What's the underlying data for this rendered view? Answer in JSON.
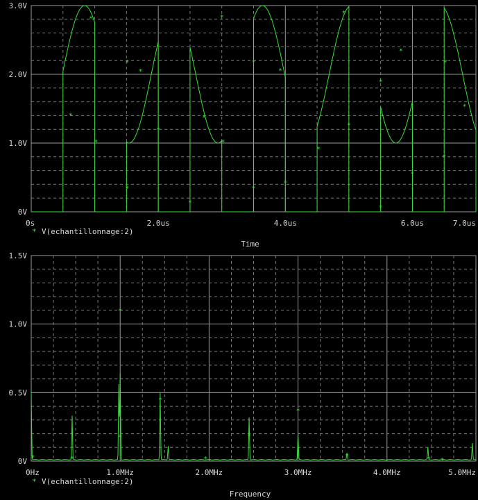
{
  "chart_data": [
    {
      "type": "line",
      "xlabel": "Time",
      "x_unit": "us",
      "ylim": [
        0,
        3.0
      ],
      "xlim": [
        0,
        7.0
      ],
      "grid": true,
      "legend_placement": "below-left",
      "series_color": "#38e038",
      "x_ticks": [
        {
          "value": 0,
          "label": "0s"
        },
        {
          "value": 2.0,
          "label": "2.0us"
        },
        {
          "value": 4.0,
          "label": "4.0us"
        },
        {
          "value": 6.0,
          "label": "6.0us"
        },
        {
          "value": 7.0,
          "label": "7.0us"
        }
      ],
      "y_ticks": [
        {
          "value": 0,
          "label": "0V"
        },
        {
          "value": 1.0,
          "label": "1.0V"
        },
        {
          "value": 2.0,
          "label": "2.0V"
        },
        {
          "value": 3.0,
          "label": "3.0V"
        }
      ],
      "signal": {
        "offset": 2.0,
        "amplitude": 1.0,
        "period_us": 1.4,
        "phase_us": 0.84
      },
      "gates": [
        {
          "on": 0.5,
          "off": 1.0
        },
        {
          "on": 1.5,
          "off": 2.0
        },
        {
          "on": 2.5,
          "off": 3.0
        },
        {
          "on": 3.5,
          "off": 4.0
        },
        {
          "on": 4.5,
          "off": 5.0
        },
        {
          "on": 5.5,
          "off": 6.0
        },
        {
          "on": 6.5,
          "off": 7.0
        }
      ],
      "series": [
        {
          "name": "V(echantillonnage:2)",
          "markers": [
            [
              0.62,
              1.41
            ],
            [
              0.94,
              2.82
            ],
            [
              1.02,
              1.02
            ],
            [
              1.51,
              0.35
            ],
            [
              1.51,
              2.18
            ],
            [
              1.72,
              2.05
            ],
            [
              2.0,
              1.2
            ],
            [
              2.5,
              0.14
            ],
            [
              2.72,
              1.38
            ],
            [
              3.02,
              1.02
            ],
            [
              3.0,
              2.84
            ],
            [
              3.5,
              0.35
            ],
            [
              3.5,
              2.18
            ],
            [
              3.92,
              2.06
            ],
            [
              4.0,
              0.43
            ],
            [
              4.52,
              0.92
            ],
            [
              4.92,
              2.9
            ],
            [
              5.0,
              1.27
            ],
            [
              5.5,
              0.07
            ],
            [
              5.5,
              1.9
            ],
            [
              5.82,
              2.35
            ],
            [
              6.0,
              0.56
            ],
            [
              6.5,
              0.81
            ],
            [
              6.52,
              2.18
            ],
            [
              6.82,
              1.54
            ]
          ]
        }
      ]
    },
    {
      "type": "line",
      "xlabel": "Frequency",
      "x_unit": "MHz",
      "ylim": [
        0,
        1.5
      ],
      "xlim": [
        0,
        5.0
      ],
      "grid": true,
      "legend_placement": "below-left",
      "series_color": "#38e038",
      "x_ticks": [
        {
          "value": 0,
          "label": "0Hz"
        },
        {
          "value": 1.0,
          "label": "1.0MHz"
        },
        {
          "value": 2.0,
          "label": "2.0MHz"
        },
        {
          "value": 3.0,
          "label": "3.0MHz"
        },
        {
          "value": 4.0,
          "label": "4.0MHz"
        },
        {
          "value": 5.0,
          "label": "5.0MHz"
        }
      ],
      "y_ticks": [
        {
          "value": 0,
          "label": "0V"
        },
        {
          "value": 0.5,
          "label": "0.5V"
        },
        {
          "value": 1.0,
          "label": "1.0V"
        },
        {
          "value": 1.5,
          "label": "1.5V"
        }
      ],
      "peaks": [
        {
          "f": 0.0,
          "v": 0.5
        },
        {
          "f": 0.46,
          "v": 0.32
        },
        {
          "f": 0.985,
          "v": 0.55
        },
        {
          "f": 1.0,
          "v": 0.63
        },
        {
          "f": 1.45,
          "v": 0.49
        },
        {
          "f": 1.54,
          "v": 0.1
        },
        {
          "f": 2.45,
          "v": 0.31
        },
        {
          "f": 3.0,
          "v": 0.2
        },
        {
          "f": 3.55,
          "v": 0.05
        },
        {
          "f": 4.46,
          "v": 0.09
        },
        {
          "f": 4.96,
          "v": 0.12
        }
      ],
      "series": [
        {
          "name": "V(echantillonnage:2)",
          "markers": [
            [
              0.02,
              0.03
            ],
            [
              0.46,
              0.02
            ],
            [
              1.0,
              1.1
            ],
            [
              1.0,
              0.18
            ],
            [
              1.45,
              0.45
            ],
            [
              1.96,
              0.02
            ],
            [
              2.45,
              0.19
            ],
            [
              3.0,
              0.37
            ],
            [
              3.55,
              0.04
            ],
            [
              4.47,
              0.02
            ],
            [
              4.62,
              0.01
            ]
          ]
        }
      ]
    }
  ]
}
